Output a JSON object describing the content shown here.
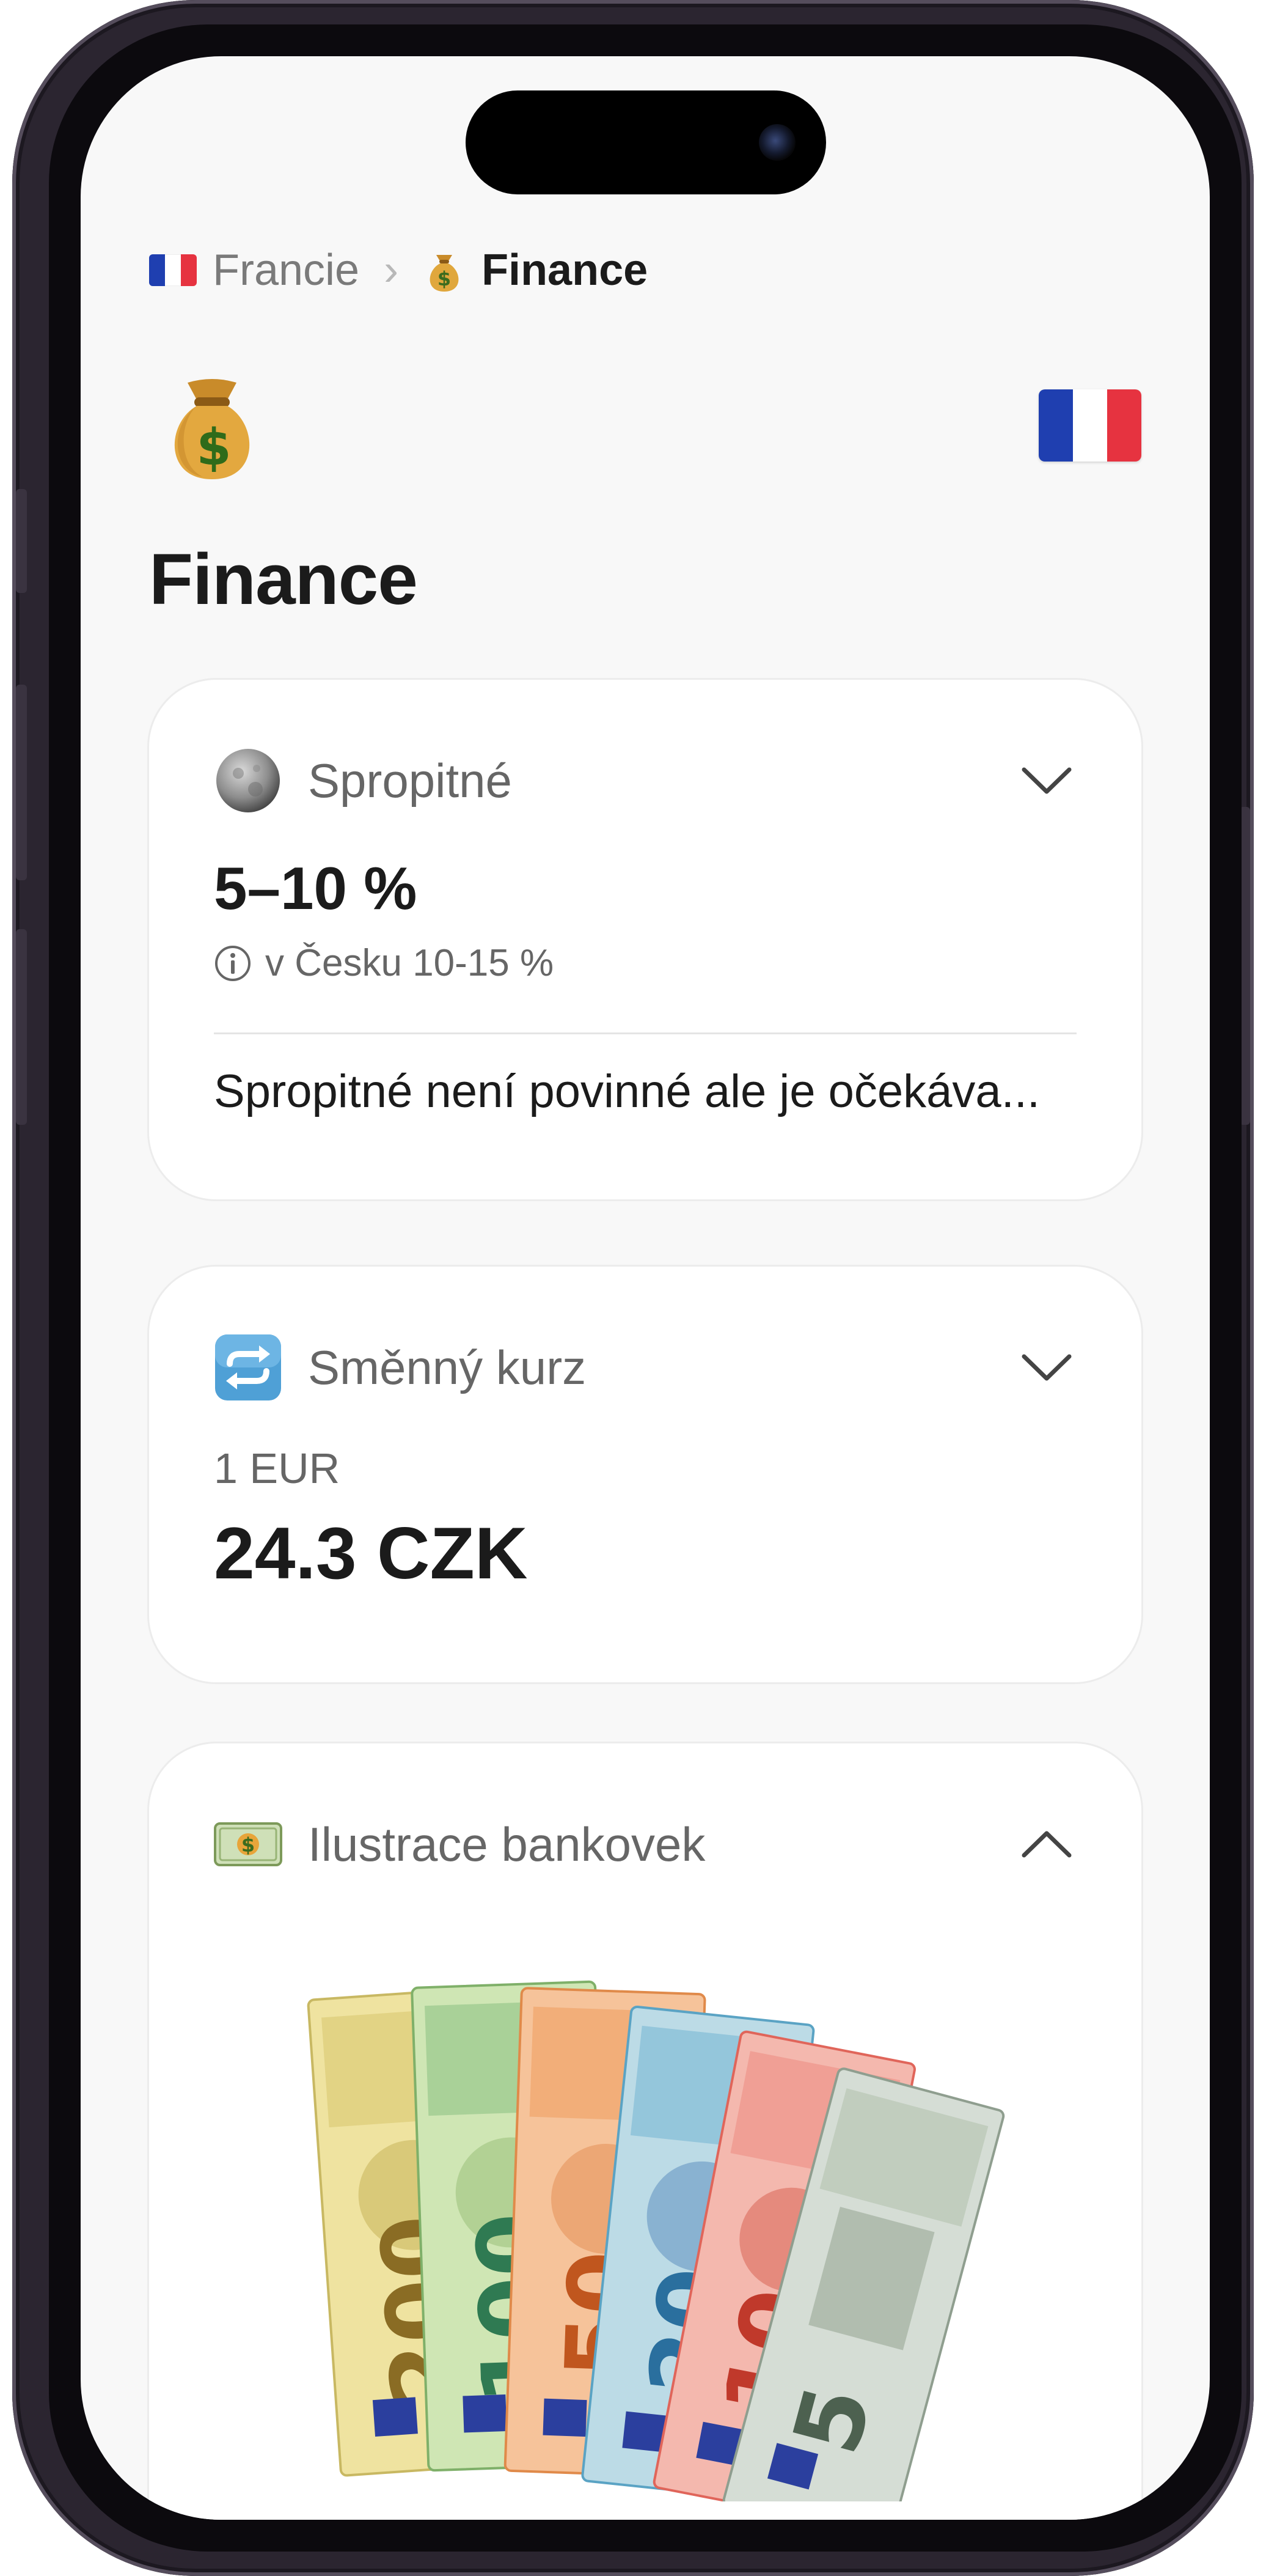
{
  "breadcrumb": {
    "country": "Francie",
    "separator": "›",
    "current_icon": "money-bag-icon",
    "current": "Finance"
  },
  "page": {
    "icon": "money-bag-icon",
    "flag": "france-flag",
    "title": "Finance"
  },
  "cards": {
    "tip": {
      "icon": "moon-icon",
      "label": "Spropitné",
      "value": "5–10 %",
      "note_icon": "info-icon",
      "note": "v Česku 10-15 %",
      "description": "Spropitné není povinné ale je očekáva...",
      "expanded": false
    },
    "exchange": {
      "icon": "repeat-arrows-icon",
      "label": "Směnný kurz",
      "base": "1 EUR",
      "value": "24.3 CZK",
      "expanded": false
    },
    "banknotes": {
      "icon": "dollar-banknote-icon",
      "label": "Ilustrace bankovek",
      "expanded": true,
      "denominations": [
        "200",
        "100",
        "50",
        "20",
        "10",
        "5"
      ]
    }
  },
  "colors": {
    "france_blue": "#1f3fb0",
    "france_white": "#ffffff",
    "france_red": "#e63340",
    "background": "#f8f8f8",
    "card": "#ffffff"
  }
}
